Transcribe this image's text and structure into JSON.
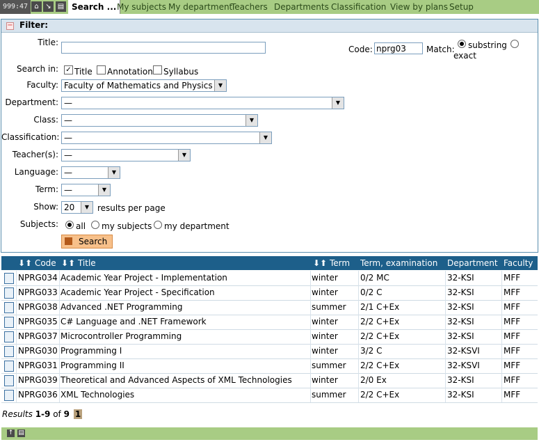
{
  "nav": {
    "clock": "999:47",
    "active_tab": "Search ...",
    "tabs": [
      "My subjects",
      "My department",
      "Teachers",
      "Departments",
      "Classification",
      "View by plans",
      "Setup"
    ]
  },
  "filter": {
    "heading": "Filter:",
    "title_label": "Title:",
    "title_value": "",
    "code_label": "Code:",
    "code_value": "nprg03",
    "match_label": "Match:",
    "match_options": [
      "substring",
      "exact"
    ],
    "search_in_label": "Search in:",
    "search_in": [
      "Title",
      "Annotation",
      "Syllabus"
    ],
    "faculty_label": "Faculty:",
    "faculty_value": "Faculty of Mathematics and Physics",
    "department_label": "Department:",
    "department_value": "—",
    "class_label": "Class:",
    "class_value": "—",
    "classification_label": "Classification:",
    "classification_value": "—",
    "teachers_label": "Teacher(s):",
    "teachers_value": "—",
    "language_label": "Language:",
    "language_value": "—",
    "term_label": "Term:",
    "term_value": "—",
    "show_label": "Show:",
    "show_value": "20",
    "show_suffix": "results per page",
    "subjects_label": "Subjects:",
    "subjects_options": [
      "all",
      "my subjects",
      "my department"
    ],
    "search_button": "Search"
  },
  "table": {
    "columns": [
      "Code",
      "Title",
      "Term",
      "Term, examination",
      "Department",
      "Faculty"
    ],
    "rows": [
      [
        "NPRG034",
        "Academic Year Project - Implementation",
        "winter",
        "0/2 MC",
        "32-KSI",
        "MFF"
      ],
      [
        "NPRG033",
        "Academic Year Project - Specification",
        "winter",
        "0/2 C",
        "32-KSI",
        "MFF"
      ],
      [
        "NPRG038",
        "Advanced .NET Programming",
        "summer",
        "2/1 C+Ex",
        "32-KSI",
        "MFF"
      ],
      [
        "NPRG035",
        "C# Language and .NET Framework",
        "winter",
        "2/2 C+Ex",
        "32-KSI",
        "MFF"
      ],
      [
        "NPRG037",
        "Microcontroller Programming",
        "winter",
        "2/2 C+Ex",
        "32-KSI",
        "MFF"
      ],
      [
        "NPRG030",
        "Programming I",
        "winter",
        "3/2 C",
        "32-KSVI",
        "MFF"
      ],
      [
        "NPRG031",
        "Programming II",
        "summer",
        "2/2 C+Ex",
        "32-KSVI",
        "MFF"
      ],
      [
        "NPRG039",
        "Theoretical and Advanced Aspects of XML Technologies",
        "winter",
        "2/0 Ex",
        "32-KSI",
        "MFF"
      ],
      [
        "NPRG036",
        "XML Technologies",
        "summer",
        "2/2 C+Ex",
        "32-KSI",
        "MFF"
      ]
    ]
  },
  "results": {
    "label": "Results",
    "range": "1-9",
    "of": "of",
    "total": "9",
    "page": "1"
  },
  "colors": {
    "nav_green": "#a8cc84",
    "header_blue": "#1d5f8a",
    "button_orange": "#f7c08a"
  }
}
